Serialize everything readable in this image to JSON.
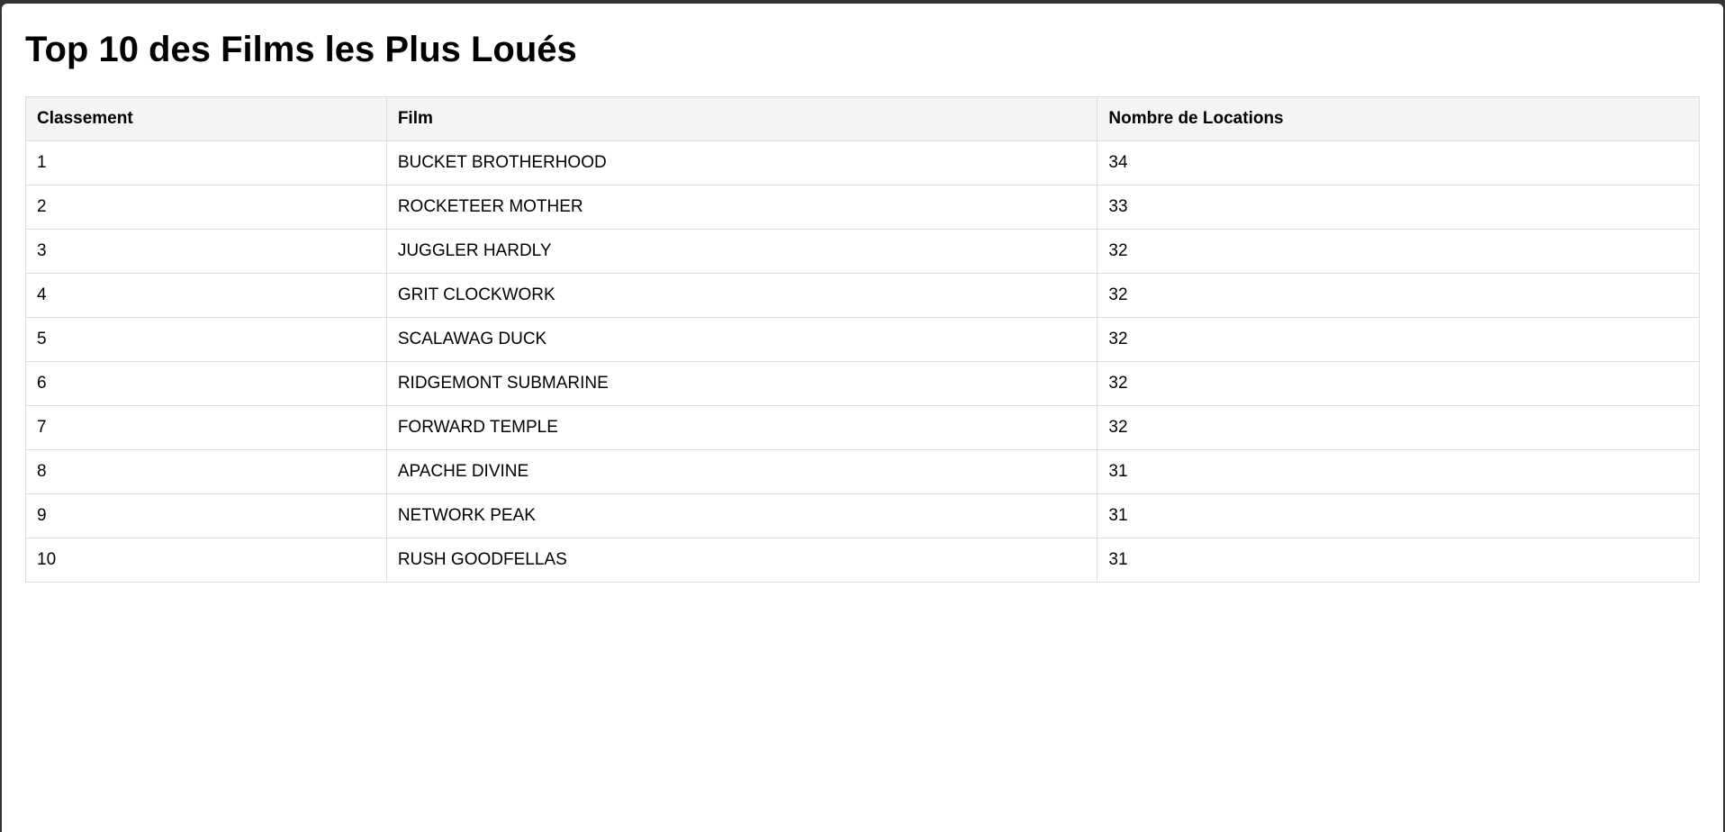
{
  "page": {
    "title": "Top 10 des Films les Plus Loués"
  },
  "table": {
    "headers": [
      "Classement",
      "Film",
      "Nombre de Locations"
    ],
    "rows": [
      [
        "1",
        "BUCKET BROTHERHOOD",
        "34"
      ],
      [
        "2",
        "ROCKETEER MOTHER",
        "33"
      ],
      [
        "3",
        "JUGGLER HARDLY",
        "32"
      ],
      [
        "4",
        "GRIT CLOCKWORK",
        "32"
      ],
      [
        "5",
        "SCALAWAG DUCK",
        "32"
      ],
      [
        "6",
        "RIDGEMONT SUBMARINE",
        "32"
      ],
      [
        "7",
        "FORWARD TEMPLE",
        "32"
      ],
      [
        "8",
        "APACHE DIVINE",
        "31"
      ],
      [
        "9",
        "NETWORK PEAK",
        "31"
      ],
      [
        "10",
        "RUSH GOODFELLAS",
        "31"
      ]
    ]
  }
}
